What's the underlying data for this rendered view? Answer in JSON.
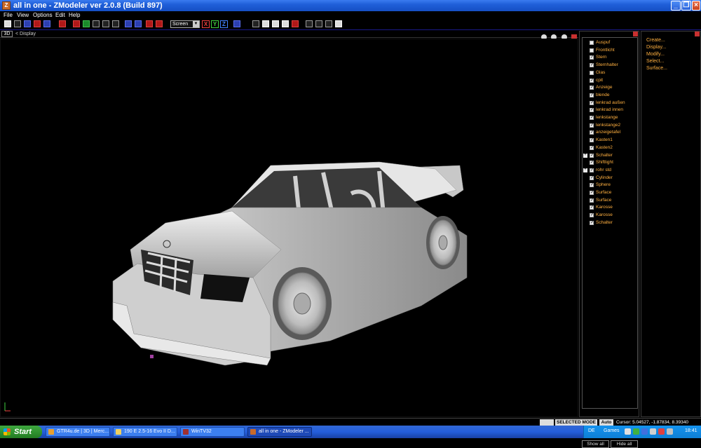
{
  "window": {
    "title": "all in one - ZModeler ver 2.0.8 (Build 897)",
    "app_icon": "Z"
  },
  "menu": [
    "File",
    "View",
    "Options",
    "Edit",
    "Help"
  ],
  "toolbar": {
    "view_select": "Screen",
    "axis_x": "X",
    "axis_y": "Y",
    "axis_z": "Z"
  },
  "viewport": {
    "tag": "3D",
    "label": "< Display"
  },
  "objects": [
    {
      "label": "Auspuf",
      "checked": false,
      "expand": false
    },
    {
      "label": "Frontlicht",
      "checked": false,
      "expand": false
    },
    {
      "label": "Stern",
      "checked": true,
      "expand": false
    },
    {
      "label": "Sternhalter",
      "checked": true,
      "expand": false
    },
    {
      "label": "Glas",
      "checked": false,
      "expand": false
    },
    {
      "label": "cpit",
      "checked": true,
      "expand": false
    },
    {
      "label": "Anzeige",
      "checked": true,
      "expand": false
    },
    {
      "label": "blende",
      "checked": true,
      "expand": false
    },
    {
      "label": "lenkrad außen",
      "checked": true,
      "expand": false
    },
    {
      "label": "lenkrad innen",
      "checked": true,
      "expand": false
    },
    {
      "label": "lenkstange",
      "checked": true,
      "expand": false
    },
    {
      "label": "lenkstange2",
      "checked": true,
      "expand": false
    },
    {
      "label": "anzeigetafel",
      "checked": true,
      "expand": false
    },
    {
      "label": "Kasten1",
      "checked": true,
      "expand": false
    },
    {
      "label": "Kasten2",
      "checked": true,
      "expand": false
    },
    {
      "label": "Schalter",
      "checked": true,
      "expand": true
    },
    {
      "label": "Shiftlight",
      "checked": true,
      "expand": false
    },
    {
      "label": "rohr std",
      "checked": true,
      "expand": true
    },
    {
      "label": "Cylinder",
      "checked": true,
      "expand": false
    },
    {
      "label": "Sphere",
      "checked": true,
      "expand": false
    },
    {
      "label": "Surface",
      "checked": true,
      "expand": false
    },
    {
      "label": "Surface",
      "checked": true,
      "expand": false
    },
    {
      "label": "Karosse",
      "checked": true,
      "expand": false
    },
    {
      "label": "Karosse",
      "checked": true,
      "expand": false
    },
    {
      "label": "Schalter",
      "checked": true,
      "expand": false
    }
  ],
  "object_buttons": {
    "show_all": "Show all",
    "hide_all": "Hide all"
  },
  "commands": [
    "Create...",
    "Display...",
    "Modify...",
    "Select...",
    "Surface..."
  ],
  "status": {
    "mode": "SELECTED MODE",
    "auto": "Auto",
    "cursor": "Cursor: 5.04527, -1.87834, 8.39340"
  },
  "taskbar": {
    "start": "Start",
    "tasks": [
      {
        "label": "GTR4u.de | 3D | Merc...",
        "active": false
      },
      {
        "label": "190 E 2.5-16 Evo II D...",
        "active": false
      },
      {
        "label": "WinTV32",
        "active": false
      },
      {
        "label": "all in one - ZModeler ...",
        "active": true
      }
    ],
    "lang": "DE",
    "games": "Games",
    "clock": "18:41"
  },
  "colors": {
    "list_text": "#ffb040",
    "titlebar": "#1f5fd8",
    "start": "#2e8f2e"
  }
}
